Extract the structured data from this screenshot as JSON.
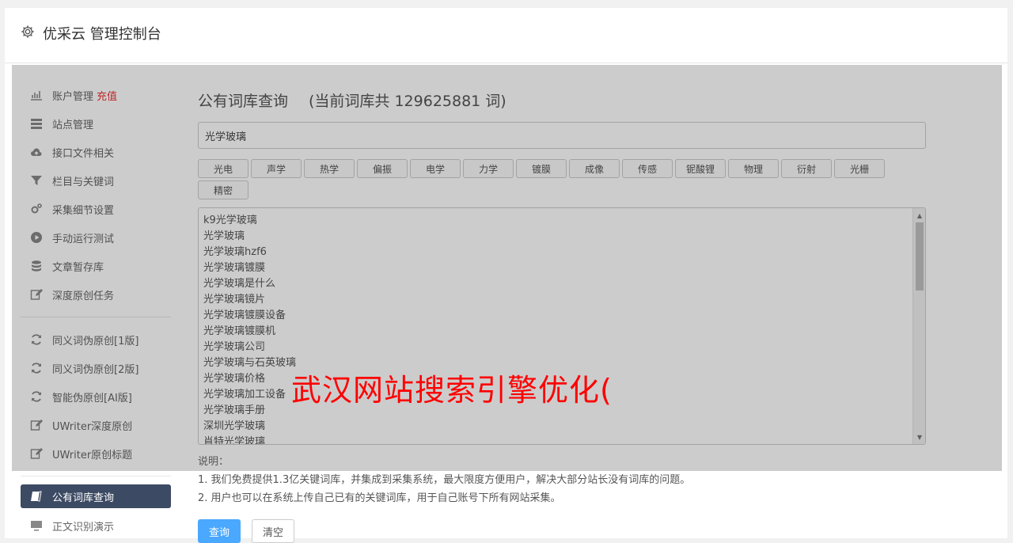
{
  "app": {
    "title": "优采云 管理控制台"
  },
  "sidebar": {
    "group1": [
      {
        "label": "账户管理",
        "extra": "充值",
        "icon": "bar-chart-icon"
      },
      {
        "label": "站点管理",
        "icon": "server-icon"
      },
      {
        "label": "接口文件相关",
        "icon": "cloud-upload-icon"
      },
      {
        "label": "栏目与关键词",
        "icon": "filter-icon"
      },
      {
        "label": "采集细节设置",
        "icon": "gears-icon"
      },
      {
        "label": "手动运行测试",
        "icon": "play-icon"
      },
      {
        "label": "文章暂存库",
        "icon": "database-icon"
      },
      {
        "label": "深度原创任务",
        "icon": "edit-icon"
      }
    ],
    "group2": [
      {
        "label": "同义词伪原创[1版]",
        "icon": "refresh-icon"
      },
      {
        "label": "同义词伪原创[2版]",
        "icon": "refresh-icon"
      },
      {
        "label": "智能伪原创[AI版]",
        "icon": "refresh-icon"
      },
      {
        "label": "UWriter深度原创",
        "icon": "edit-icon"
      },
      {
        "label": "UWriter原创标题",
        "icon": "edit-icon"
      }
    ],
    "group3": [
      {
        "label": "公有词库查询",
        "icon": "book-icon",
        "active": true
      },
      {
        "label": "正文识别演示",
        "icon": "monitor-icon"
      }
    ]
  },
  "page": {
    "title": "公有词库查询",
    "count_text": "(当前词库共 129625881 词)",
    "search_value": "光学玻璃",
    "tags": [
      "光电",
      "声学",
      "热学",
      "偏振",
      "电学",
      "力学",
      "镀膜",
      "成像",
      "传感",
      "铌酸锂",
      "物理",
      "衍射",
      "光栅",
      "精密"
    ],
    "results": [
      "k9光学玻璃",
      "光学玻璃",
      "光学玻璃hzf6",
      "光学玻璃镀膜",
      "光学玻璃是什么",
      "光学玻璃镜片",
      "光学玻璃镀膜设备",
      "光学玻璃镀膜机",
      "光学玻璃公司",
      "光学玻璃与石英玻璃",
      "光学玻璃价格",
      "光学玻璃加工设备",
      "光学玻璃手册",
      "深圳光学玻璃",
      "肖特光学玻璃"
    ],
    "notes_title": "说明：",
    "notes": [
      "1. 我们免费提供1.3亿关键词库，并集成到采集系统，最大限度方便用户，解决大部分站长没有词库的问题。",
      "2. 用户也可以在系统上传自己已有的关键词库，用于自己账号下所有网站采集。"
    ],
    "query_button": "查询",
    "clear_button": "清空"
  },
  "watermark": "武汉网站搜索引擎优化(",
  "colors": {
    "active_bg": "#3c4a63",
    "primary": "#4aa8ff",
    "recharge": "#e33333",
    "watermark": "#ff0000"
  }
}
